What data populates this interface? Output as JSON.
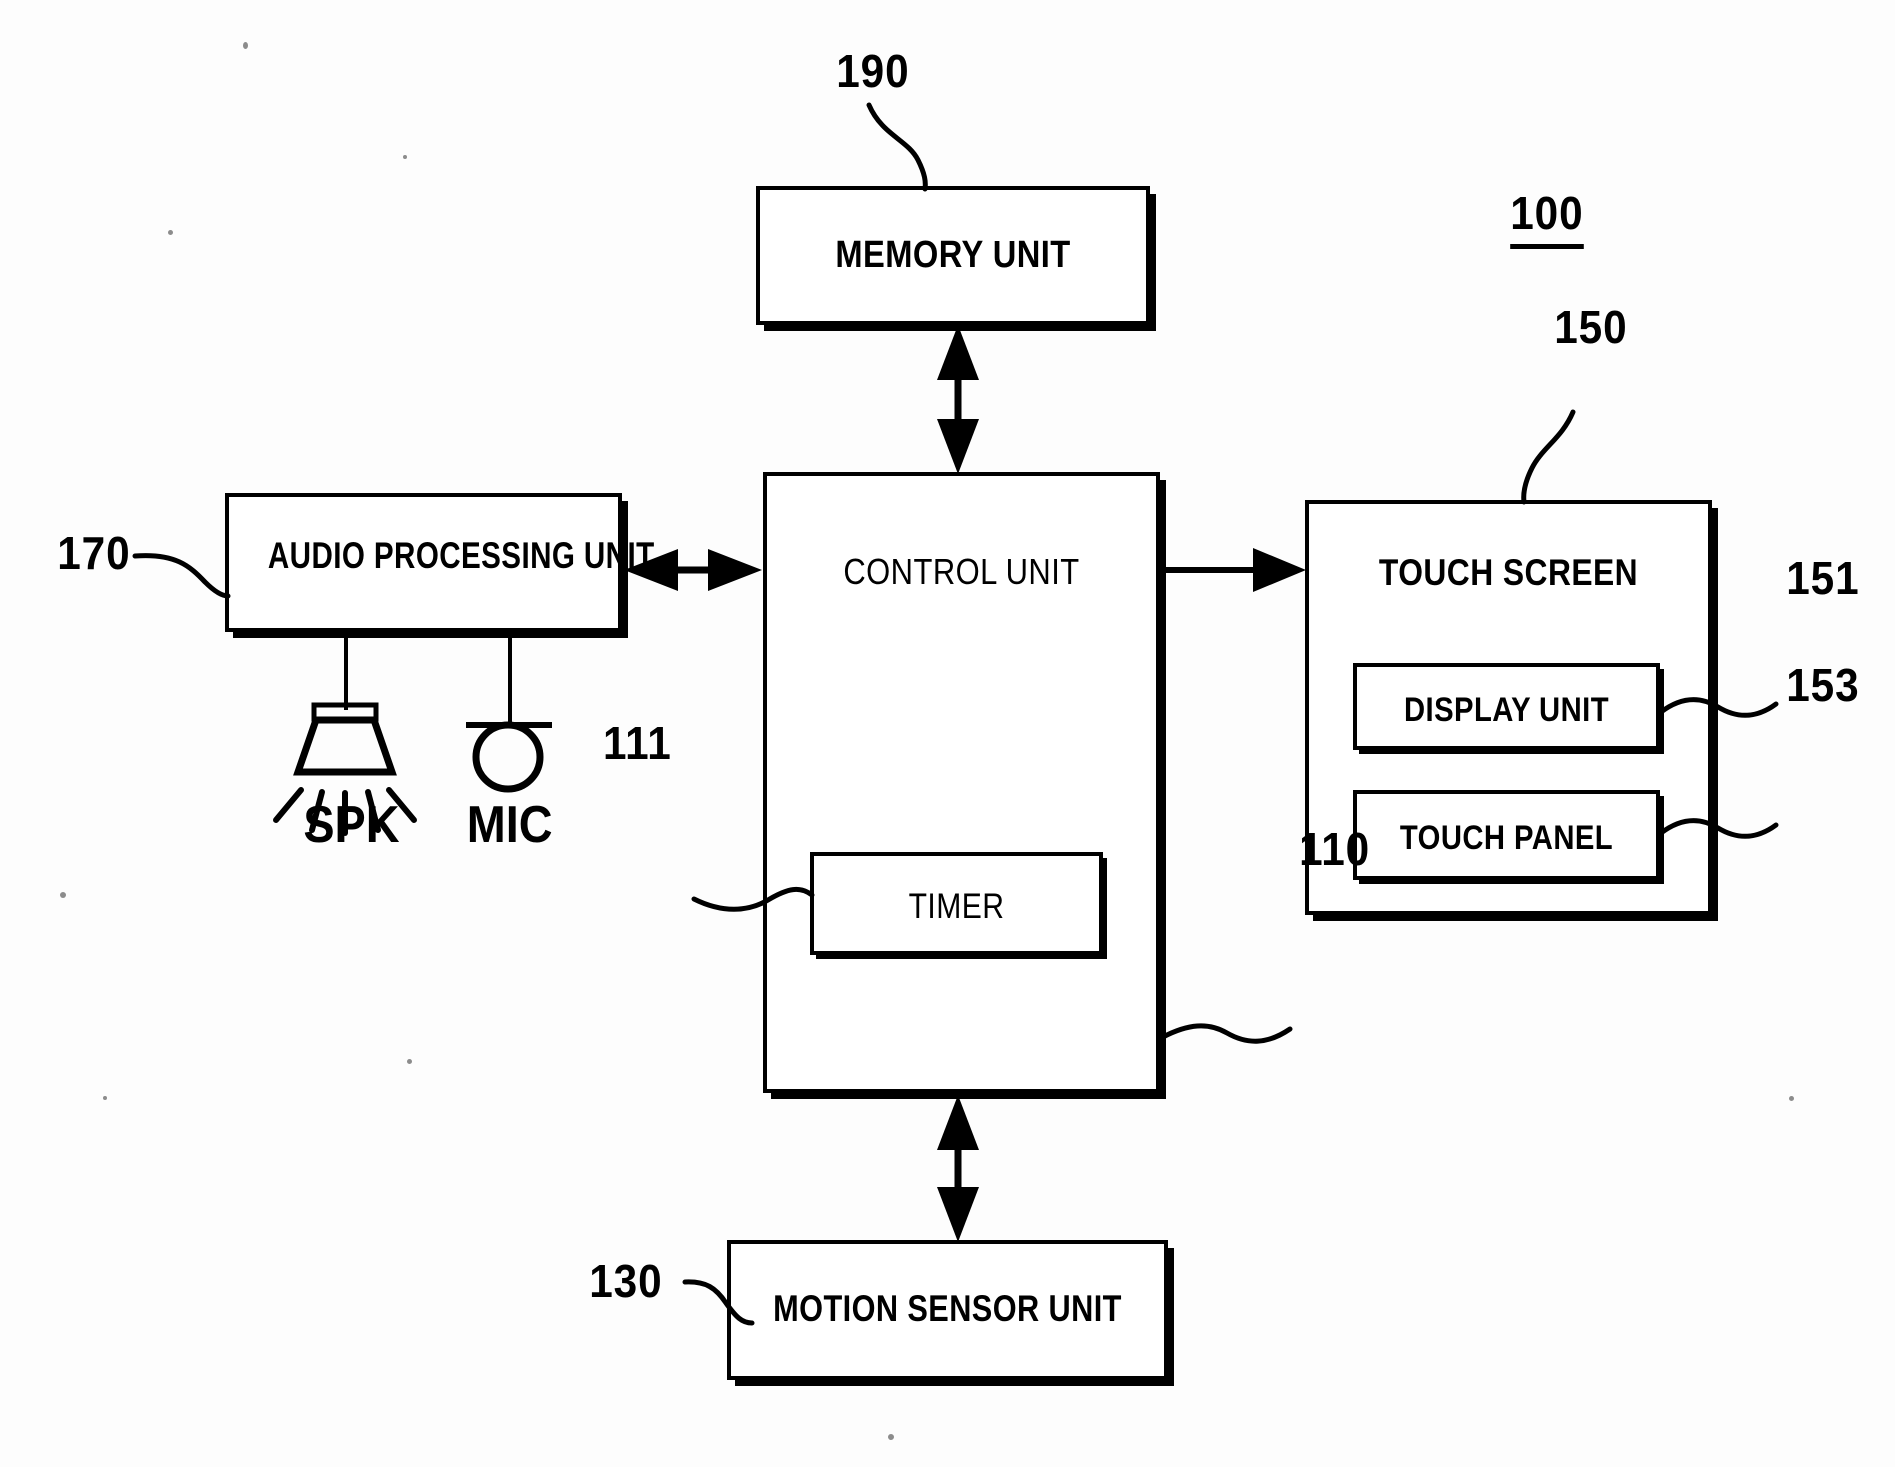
{
  "figure": {
    "type": "patent-block-diagram",
    "device_numeral": "100",
    "blocks": [
      {
        "id": "memory",
        "label": "MEMORY UNIT",
        "numeral": "190"
      },
      {
        "id": "control",
        "label": "CONTROL UNIT",
        "numeral": "110"
      },
      {
        "id": "timer",
        "label": "TIMER",
        "numeral": "111"
      },
      {
        "id": "audio",
        "label": "AUDIO PROCESSING UNIT",
        "numeral": "170"
      },
      {
        "id": "touchscreen",
        "label": "TOUCH SCREEN",
        "numeral": "150"
      },
      {
        "id": "display",
        "label": "DISPLAY UNIT",
        "numeral": "151"
      },
      {
        "id": "touchpanel",
        "label": "TOUCH PANEL",
        "numeral": "153"
      },
      {
        "id": "motion",
        "label": "MOTION SENSOR UNIT",
        "numeral": "130"
      }
    ],
    "peripherals": [
      {
        "id": "speaker",
        "label": "SPK",
        "icon": "speaker-icon"
      },
      {
        "id": "microphone",
        "label": "MIC",
        "icon": "microphone-icon"
      }
    ],
    "connections": [
      {
        "from": "memory",
        "to": "control",
        "style": "double-arrow",
        "orientation": "vertical"
      },
      {
        "from": "audio",
        "to": "control",
        "style": "double-arrow",
        "orientation": "horizontal"
      },
      {
        "from": "control",
        "to": "touchscreen",
        "style": "single-arrow",
        "orientation": "horizontal"
      },
      {
        "from": "control",
        "to": "motion",
        "style": "double-arrow",
        "orientation": "vertical"
      },
      {
        "from": "audio",
        "to": "speaker",
        "style": "line",
        "orientation": "vertical"
      },
      {
        "from": "audio",
        "to": "microphone",
        "style": "line",
        "orientation": "vertical"
      }
    ],
    "colors": {
      "ink": "#000000",
      "paper": "#ffffff"
    }
  },
  "labels": {
    "memory_unit": "MEMORY UNIT",
    "control_unit": "CONTROL UNIT",
    "timer": "TIMER",
    "audio_processing_unit": "AUDIO PROCESSING UNIT",
    "touch_screen": "TOUCH SCREEN",
    "display_unit": "DISPLAY UNIT",
    "touch_panel": "TOUCH PANEL",
    "motion_sensor_unit": "MOTION SENSOR UNIT",
    "spk": "SPK",
    "mic": "MIC"
  },
  "numerals": {
    "n100": "100",
    "n110": "110",
    "n111": "111",
    "n130": "130",
    "n150": "150",
    "n151": "151",
    "n153": "153",
    "n170": "170",
    "n190": "190"
  }
}
